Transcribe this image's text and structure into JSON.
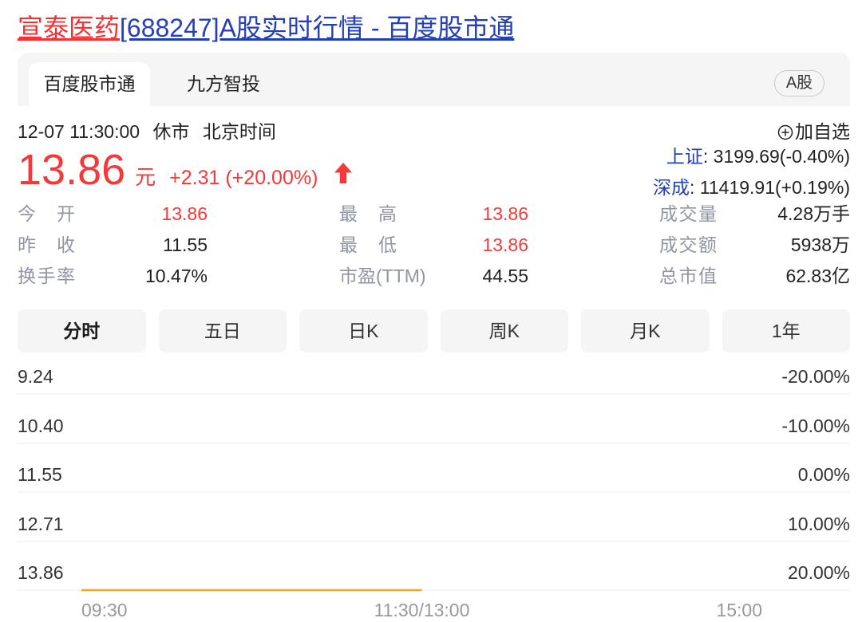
{
  "page_title": {
    "highlight": "宣泰医药",
    "rest": "[688247]A股实时行情 - 百度股市通"
  },
  "colors": {
    "title_highlight": "#f73131",
    "link": "#2440b3",
    "up": "#f23a3a",
    "label": "#9195a3"
  },
  "source_tabs": [
    {
      "label": "百度股市通",
      "active": true
    },
    {
      "label": "九方智投",
      "active": false
    }
  ],
  "market_badge": "A股",
  "status": {
    "datetime": "12-07 11:30:00",
    "state": "休市",
    "timezone": "北京时间"
  },
  "watchlist": {
    "label": "加自选",
    "icon": "circle-plus-icon"
  },
  "quote": {
    "price": "13.86",
    "unit": "元",
    "change": "+2.31 (+20.00%)",
    "is_up": true,
    "trend_icon": "arrow-up-icon"
  },
  "indices": [
    {
      "name": "上证",
      "value": ": 3199.69(-0.40%)"
    },
    {
      "name": "深成",
      "value": ": 11419.91(+0.19%)"
    }
  ],
  "stats": [
    [
      {
        "label": "今 开",
        "value": "13.86",
        "up": true
      },
      {
        "label": "最 高",
        "value": "13.86",
        "up": true
      },
      {
        "label": "成交量",
        "value": "4.28万手",
        "up": false
      }
    ],
    [
      {
        "label": "昨 收",
        "value": "11.55",
        "up": false
      },
      {
        "label": "最 低",
        "value": "13.86",
        "up": true
      },
      {
        "label": "成交额",
        "value": "5938万",
        "up": false
      }
    ],
    [
      {
        "label": "换手率",
        "value": "10.47%",
        "up": false
      },
      {
        "label": "市盈(TTM)",
        "value": "44.55",
        "up": false
      },
      {
        "label": "总市值",
        "value": "62.83亿",
        "up": false
      }
    ]
  ],
  "periods": [
    {
      "label": "分时",
      "active": true
    },
    {
      "label": "五日",
      "active": false
    },
    {
      "label": "日K",
      "active": false
    },
    {
      "label": "周K",
      "active": false
    },
    {
      "label": "月K",
      "active": false
    },
    {
      "label": "1年",
      "active": false
    }
  ],
  "chart_data": {
    "type": "line",
    "xlim": [
      "09:30",
      "15:00"
    ],
    "ylim": [
      9.24,
      13.86
    ],
    "y_inverted": true,
    "grid": true,
    "x_ticks": [
      "09:30",
      "11:30/13:00",
      "15:00"
    ],
    "y_ticks_left": [
      "9.24",
      "10.40",
      "11.55",
      "12.71",
      "13.86"
    ],
    "y_ticks_right": [
      "-20.00%",
      "-10.00%",
      "0.00%",
      "10.00%",
      "20.00%"
    ],
    "series": [
      {
        "x": [
          "09:30",
          "11:30"
        ],
        "y": [
          13.86,
          13.86
        ],
        "color": "#f5a623"
      }
    ]
  }
}
